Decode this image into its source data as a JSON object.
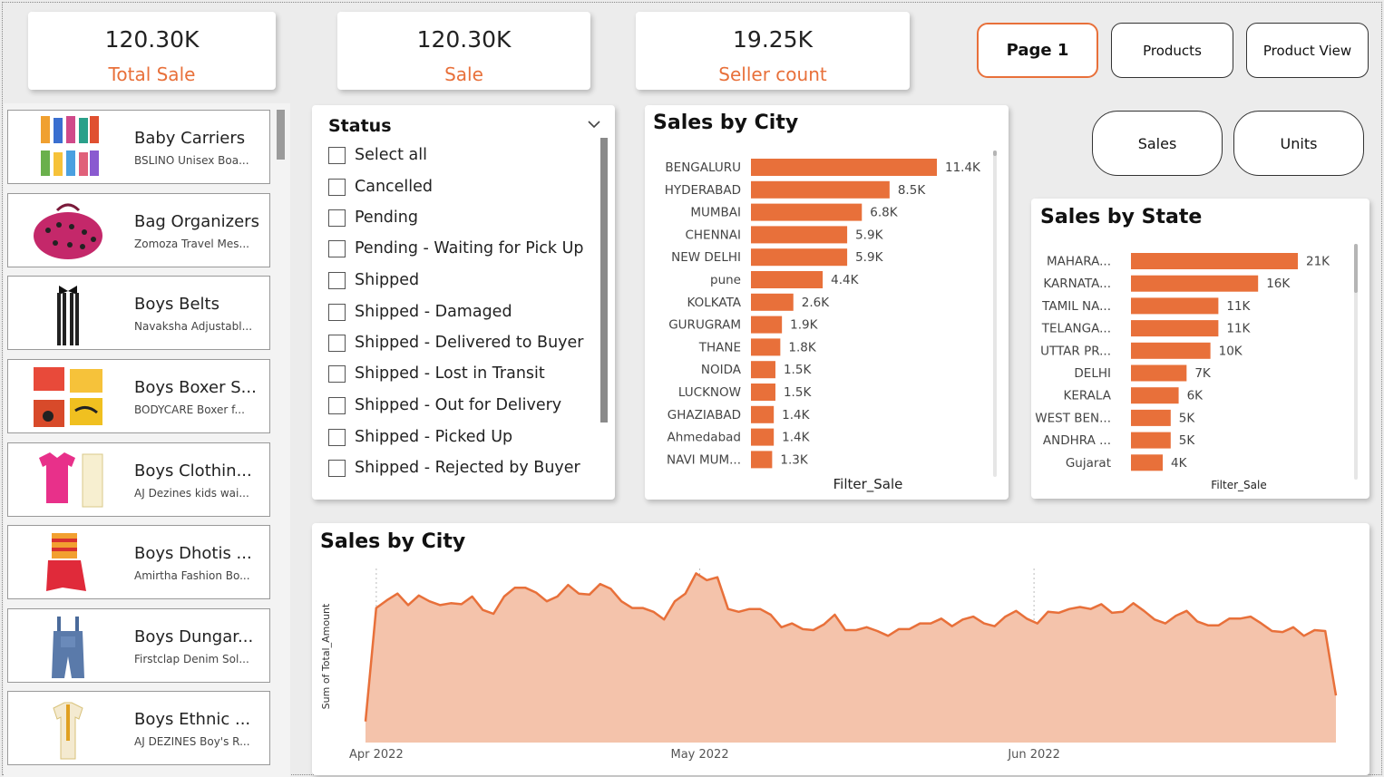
{
  "kpis": [
    {
      "value": "120.30K",
      "label": "Total Sale"
    },
    {
      "value": "120.30K",
      "label": "Sale"
    },
    {
      "value": "19.25K",
      "label": "Seller count"
    }
  ],
  "nav": {
    "page1": "Page 1",
    "products": "Products",
    "product_view": "Product View",
    "sales": "Sales",
    "units": "Units"
  },
  "products": [
    {
      "title": "Baby Carriers",
      "subtitle": "BSLINO Unisex Boa...",
      "image": "socks-image"
    },
    {
      "title": "Bag Organizers",
      "subtitle": "Zomoza Travel Mes...",
      "image": "polka-bag-image"
    },
    {
      "title": "Boys Belts",
      "subtitle": "Navaksha Adjustabl...",
      "image": "suspenders-image"
    },
    {
      "title": "Boys Boxer S...",
      "subtitle": "BODYCARE Boxer f...",
      "image": "boxer-shorts-image"
    },
    {
      "title": "Boys Clothin...",
      "subtitle": "AJ Dezines kids wai...",
      "image": "pink-shirt-image"
    },
    {
      "title": "Boys Dhotis ...",
      "subtitle": "Amirtha Fashion Bo...",
      "image": "dhoti-set-image"
    },
    {
      "title": "Boys Dungar...",
      "subtitle": "Firstclap Denim Sol...",
      "image": "denim-dungaree-image"
    },
    {
      "title": "Boys Ethnic ...",
      "subtitle": "AJ DEZINES Boy's R...",
      "image": "ethnic-wear-image"
    }
  ],
  "status_slicer": {
    "title": "Status",
    "options": [
      "Select all",
      "Cancelled",
      "Pending",
      "Pending - Waiting for Pick Up",
      "Shipped",
      "Shipped - Damaged",
      "Shipped - Delivered to Buyer",
      "Shipped - Lost in Transit",
      "Shipped - Out for Delivery",
      "Shipped - Picked Up",
      "Shipped - Rejected by Buyer"
    ]
  },
  "accent_color": "#e8703a",
  "area_fill_color": "#f4c3ab",
  "chart_data": [
    {
      "type": "bar",
      "orientation": "horizontal",
      "title": "Sales by City",
      "xlabel": "Filter_Sale",
      "categories": [
        "BENGALURU",
        "HYDERABAD",
        "MUMBAI",
        "CHENNAI",
        "NEW DELHI",
        "pune",
        "KOLKATA",
        "GURUGRAM",
        "THANE",
        "NOIDA",
        "LUCKNOW",
        "GHAZIABAD",
        "Ahmedabad",
        "NAVI MUM..."
      ],
      "values": [
        11400,
        8500,
        6800,
        5900,
        5900,
        4400,
        2600,
        1900,
        1800,
        1500,
        1500,
        1400,
        1400,
        1300
      ],
      "labels": [
        "11.4K",
        "8.5K",
        "6.8K",
        "5.9K",
        "5.9K",
        "4.4K",
        "2.6K",
        "1.9K",
        "1.8K",
        "1.5K",
        "1.5K",
        "1.4K",
        "1.4K",
        "1.3K"
      ]
    },
    {
      "type": "bar",
      "orientation": "horizontal",
      "title": "Sales by State",
      "xlabel": "Filter_Sale",
      "categories": [
        "MAHARA...",
        "KARNATA...",
        "TAMIL NA...",
        "TELANGA...",
        "UTTAR PR...",
        "DELHI",
        "KERALA",
        "WEST BEN...",
        "ANDHRA ...",
        "Gujarat"
      ],
      "values": [
        21000,
        16000,
        11000,
        11000,
        10000,
        7000,
        6000,
        5000,
        5000,
        4000
      ],
      "labels": [
        "21K",
        "16K",
        "11K",
        "11K",
        "10K",
        "7K",
        "6K",
        "5K",
        "5K",
        "4K"
      ]
    },
    {
      "type": "area",
      "title": "Sales by City",
      "ylabel": "Sum of Total_Amount",
      "x_ticks": [
        "Apr 2022",
        "May 2022",
        "Jun 2022"
      ],
      "x_range": [
        "2022-03-31",
        "2022-06-29"
      ],
      "x_tick_dates": [
        "2022-04-01",
        "2022-05-01",
        "2022-06-01"
      ],
      "values": [
        220,
        1400,
        1480,
        1550,
        1430,
        1530,
        1470,
        1430,
        1450,
        1440,
        1520,
        1380,
        1340,
        1520,
        1610,
        1610,
        1560,
        1470,
        1520,
        1640,
        1550,
        1540,
        1650,
        1600,
        1470,
        1400,
        1400,
        1360,
        1280,
        1470,
        1550,
        1760,
        1690,
        1720,
        1390,
        1360,
        1390,
        1390,
        1330,
        1200,
        1240,
        1180,
        1170,
        1230,
        1330,
        1170,
        1170,
        1200,
        1160,
        1110,
        1180,
        1180,
        1240,
        1240,
        1290,
        1210,
        1280,
        1310,
        1240,
        1210,
        1310,
        1370,
        1290,
        1240,
        1360,
        1350,
        1390,
        1410,
        1390,
        1440,
        1350,
        1360,
        1450,
        1370,
        1280,
        1240,
        1320,
        1370,
        1260,
        1220,
        1220,
        1290,
        1290,
        1310,
        1240,
        1160,
        1150,
        1200,
        1110,
        1170,
        1160,
        490
      ]
    }
  ]
}
